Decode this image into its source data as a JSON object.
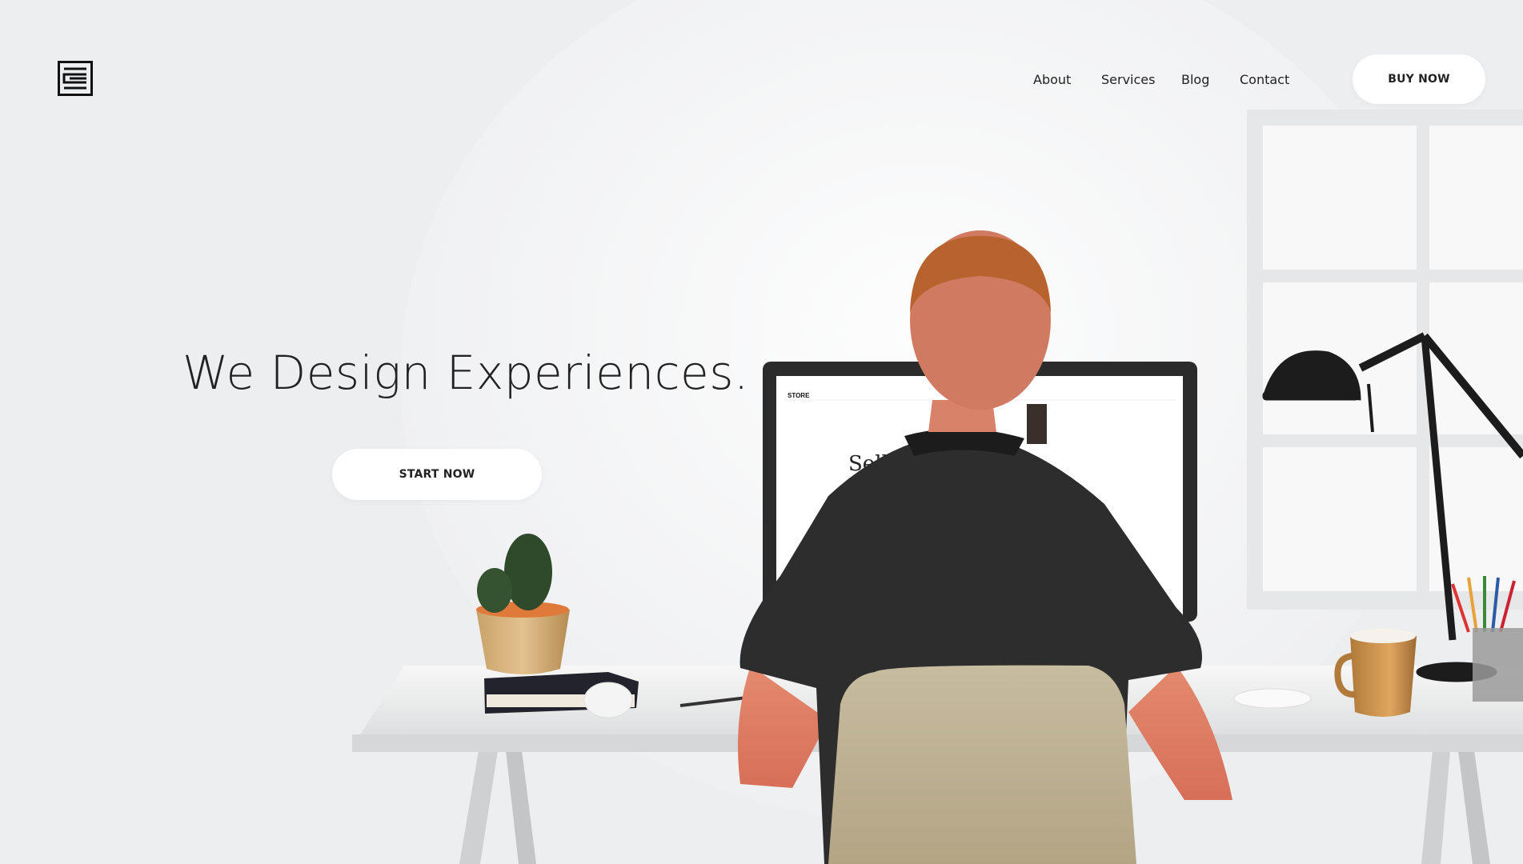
{
  "header": {
    "logo_icon": "stacked-lines-logo-icon",
    "nav": [
      {
        "label": "About"
      },
      {
        "label": "Services"
      },
      {
        "label": "Blog"
      },
      {
        "label": "Contact"
      }
    ],
    "cta_label": "BUY NOW"
  },
  "hero": {
    "title": "We Design Experiences.",
    "cta_label": "START NOW"
  },
  "monitor_screen": {
    "store_label": "STORE",
    "headline": "Sell yo"
  },
  "colors": {
    "background": "#edeef0",
    "button_bg": "#ffffff",
    "text": "#222222"
  }
}
